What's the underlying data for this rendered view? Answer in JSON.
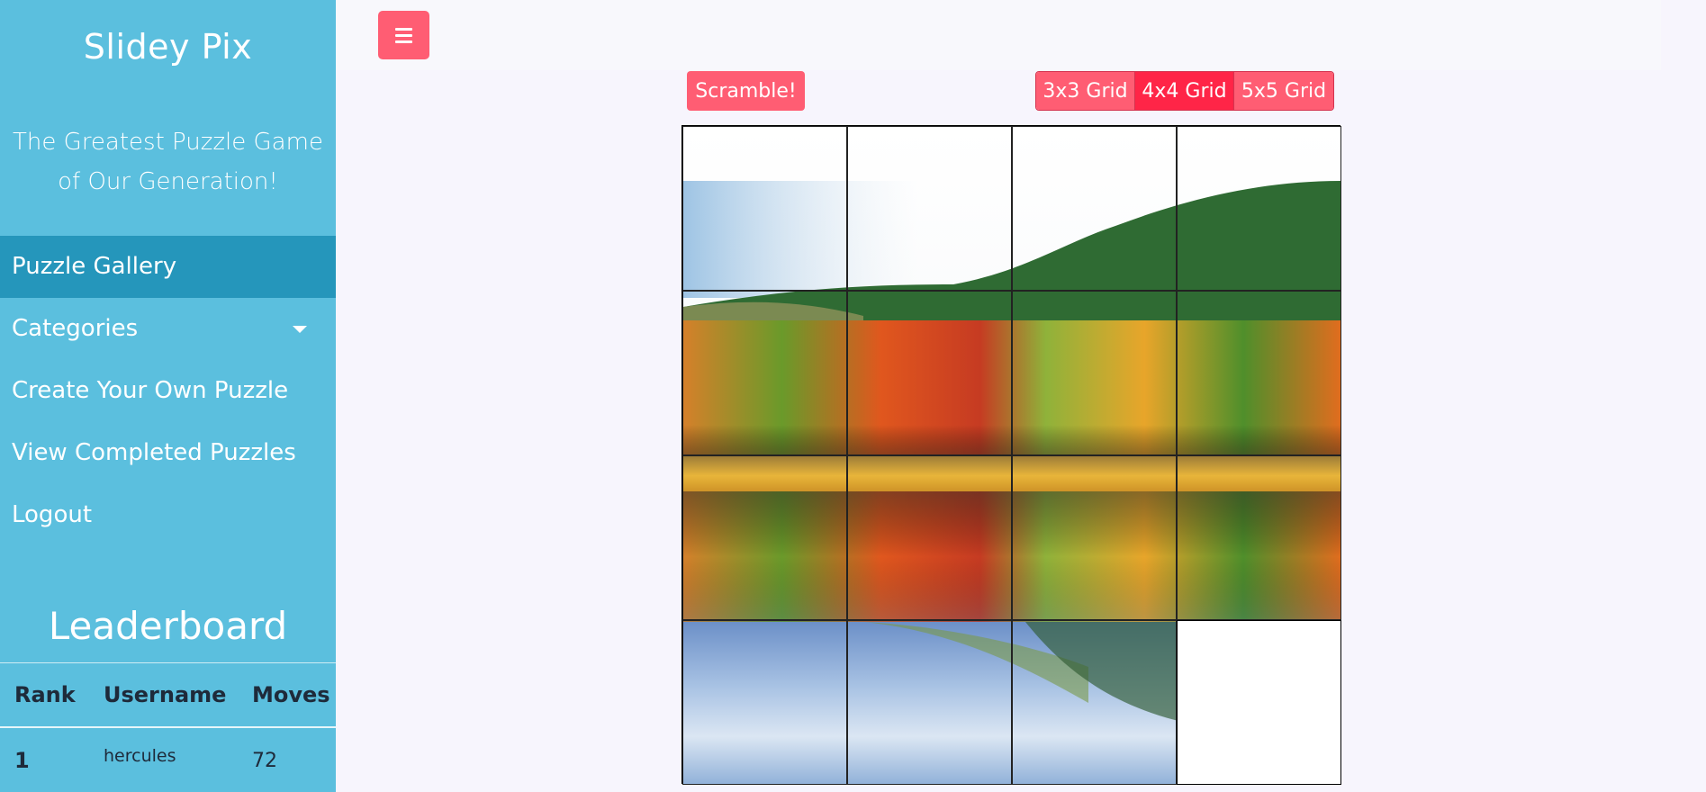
{
  "sidebar": {
    "brand": "Slidey Pix",
    "tagline": "The Greatest Puzzle Game of Our Generation!",
    "nav": {
      "gallery": "Puzzle Gallery",
      "categories": "Categories",
      "create": "Create Your Own Puzzle",
      "completed": "View Completed Puzzles",
      "logout": "Logout"
    },
    "leaderboard": {
      "title": "Leaderboard",
      "headers": {
        "rank": "Rank",
        "username": "Username",
        "moves": "Moves"
      },
      "rows": [
        {
          "rank": "1",
          "username": "hercules",
          "moves": "72"
        }
      ]
    }
  },
  "topbar": {
    "menu_icon": "hamburger-menu-icon"
  },
  "controls": {
    "scramble": "Scramble!",
    "grid_options": [
      "3x3 Grid",
      "4x4 Grid",
      "5x5 Grid"
    ],
    "selected_grid": "4x4 Grid"
  },
  "puzzle": {
    "image": "autumn lake landscape",
    "grid_size": 4,
    "empty_tile": "row 4, column 4"
  },
  "colors": {
    "sidebar_bg": "#5bbfde",
    "sidebar_active": "#2596bb",
    "accent": "#ff5d73",
    "accent_active": "#ff2547",
    "page_bg": "#f7f5fd"
  }
}
